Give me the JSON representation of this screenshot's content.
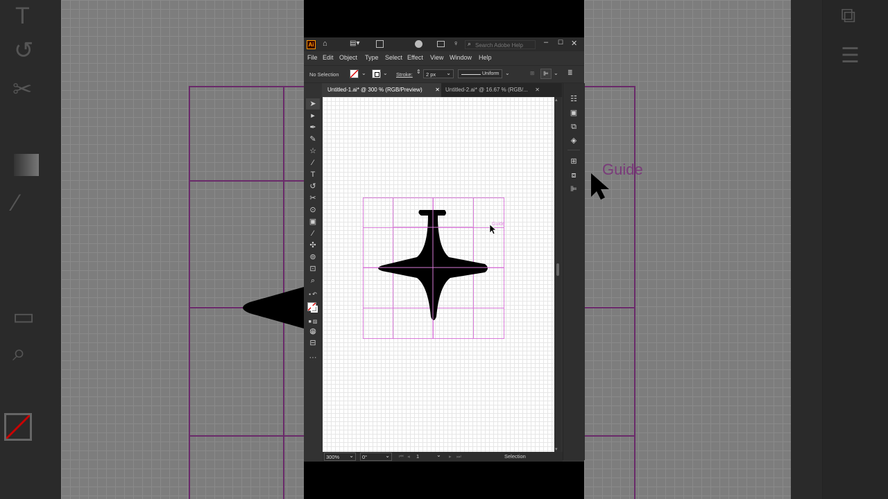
{
  "background": {
    "guide_word": "Guide"
  },
  "app": {
    "logo": "Ai",
    "search_placeholder": "Search Adobe Help"
  },
  "menu": [
    "File",
    "Edit",
    "Object",
    "Type",
    "Select",
    "Effect",
    "View",
    "Window",
    "Help"
  ],
  "control_bar": {
    "selection_status": "No Selection",
    "stroke_label": "Stroke:",
    "stroke_weight": "2 px",
    "stroke_profile": "Uniform"
  },
  "tabs": [
    {
      "label": "Untitled-1.ai* @ 300 % (RGB/Preview)",
      "active": true
    },
    {
      "label": "Untitled-2.ai* @ 16.67 % (RGB/...",
      "active": false
    }
  ],
  "canvas": {
    "guide_label": "Guide",
    "fill_color": "#000000",
    "guide_color": "#d87ad8"
  },
  "status_bar": {
    "zoom": "300%",
    "rotation": "0°",
    "artboard": "1",
    "tool": "Selection"
  },
  "icons": {
    "home": "home-icon",
    "workspace": "workspace-switcher-icon",
    "search": "search-icon"
  }
}
